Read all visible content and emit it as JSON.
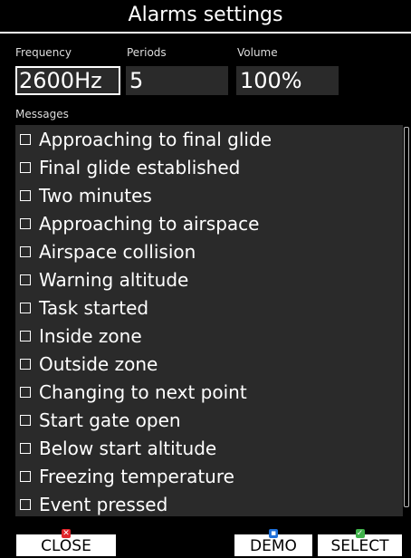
{
  "title": "Alarms settings",
  "fields": {
    "frequency": {
      "label": "Frequency",
      "value": "2600Hz"
    },
    "periods": {
      "label": "Periods",
      "value": "5"
    },
    "volume": {
      "label": "Volume",
      "value": "100%"
    }
  },
  "messages_label": "Messages",
  "messages": [
    {
      "label": "Approaching to final glide",
      "checked": false
    },
    {
      "label": "Final glide established",
      "checked": false
    },
    {
      "label": "Two minutes",
      "checked": false
    },
    {
      "label": "Approaching to airspace",
      "checked": false
    },
    {
      "label": "Airspace collision",
      "checked": false
    },
    {
      "label": "Warning altitude",
      "checked": false
    },
    {
      "label": "Task started",
      "checked": false
    },
    {
      "label": "Inside zone",
      "checked": false
    },
    {
      "label": "Outside zone",
      "checked": false
    },
    {
      "label": "Changing to next point",
      "checked": false
    },
    {
      "label": "Start gate open",
      "checked": false
    },
    {
      "label": "Below start altitude",
      "checked": false
    },
    {
      "label": "Freezing temperature",
      "checked": false
    },
    {
      "label": "Event pressed",
      "checked": false
    }
  ],
  "buttons": {
    "close": {
      "label": "CLOSE",
      "indicator_color": "#e0242a",
      "icon": "close-x-icon"
    },
    "demo": {
      "label": "DEMO",
      "indicator_color": "#1e6fd9",
      "icon": "square-dot-icon"
    },
    "select": {
      "label": "SELECT",
      "indicator_color": "#3fb24a",
      "icon": "check-icon"
    }
  }
}
